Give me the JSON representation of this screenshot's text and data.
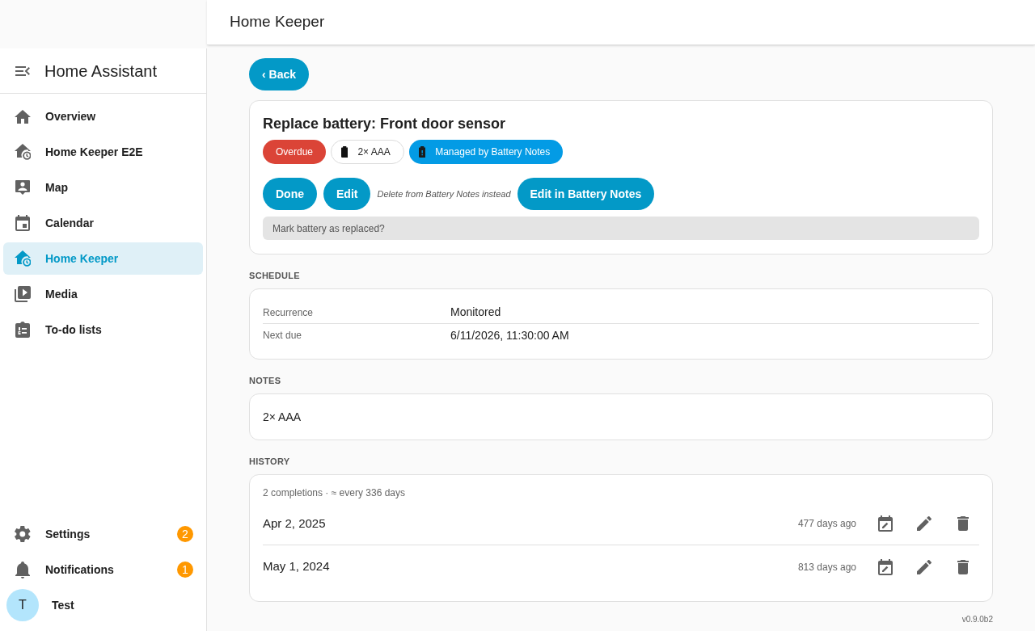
{
  "header": {
    "title": "Home Keeper"
  },
  "sidebar": {
    "title": "Home Assistant",
    "items": [
      {
        "label": "Overview",
        "selected": false
      },
      {
        "label": "Home Keeper E2E",
        "selected": false
      },
      {
        "label": "Map",
        "selected": false
      },
      {
        "label": "Calendar",
        "selected": false
      },
      {
        "label": "Home Keeper",
        "selected": true
      },
      {
        "label": "Media",
        "selected": false
      },
      {
        "label": "To-do lists",
        "selected": false
      }
    ],
    "footer_items": [
      {
        "label": "Settings",
        "badge": "2"
      },
      {
        "label": "Notifications",
        "badge": "1"
      }
    ],
    "user": {
      "initial": "T",
      "name": "Test"
    }
  },
  "back_button": {
    "label": "‹ Back"
  },
  "task": {
    "title": "Replace battery: Front door sensor",
    "chips": [
      {
        "kind": "status",
        "label": "Overdue"
      },
      {
        "kind": "battery",
        "label": "2× AAA"
      },
      {
        "kind": "managed",
        "label": "Managed by Battery Notes"
      }
    ],
    "actions": [
      {
        "kind": "button",
        "label": "Done"
      },
      {
        "kind": "button",
        "label": "Edit"
      },
      {
        "kind": "link",
        "label": "Delete from Battery Notes instead"
      },
      {
        "kind": "button",
        "label": "Edit in Battery Notes"
      }
    ],
    "hint": "Mark battery as replaced?"
  },
  "schedule": {
    "heading": "SCHEDULE",
    "rows": [
      {
        "label": "Recurrence",
        "value": "Monitored"
      },
      {
        "label": "Next due",
        "value": "6/11/2026, 11:30:00 AM"
      }
    ]
  },
  "notes": {
    "heading": "NOTES",
    "text": "2× AAA"
  },
  "history": {
    "heading": "HISTORY",
    "summary": "2 completions · ≈ every 336 days",
    "entries": [
      {
        "date": "Apr 2, 2025",
        "ago": "477 days ago"
      },
      {
        "date": "May 1, 2024",
        "ago": "813 days ago"
      }
    ]
  },
  "version": "v0.9.0b2"
}
